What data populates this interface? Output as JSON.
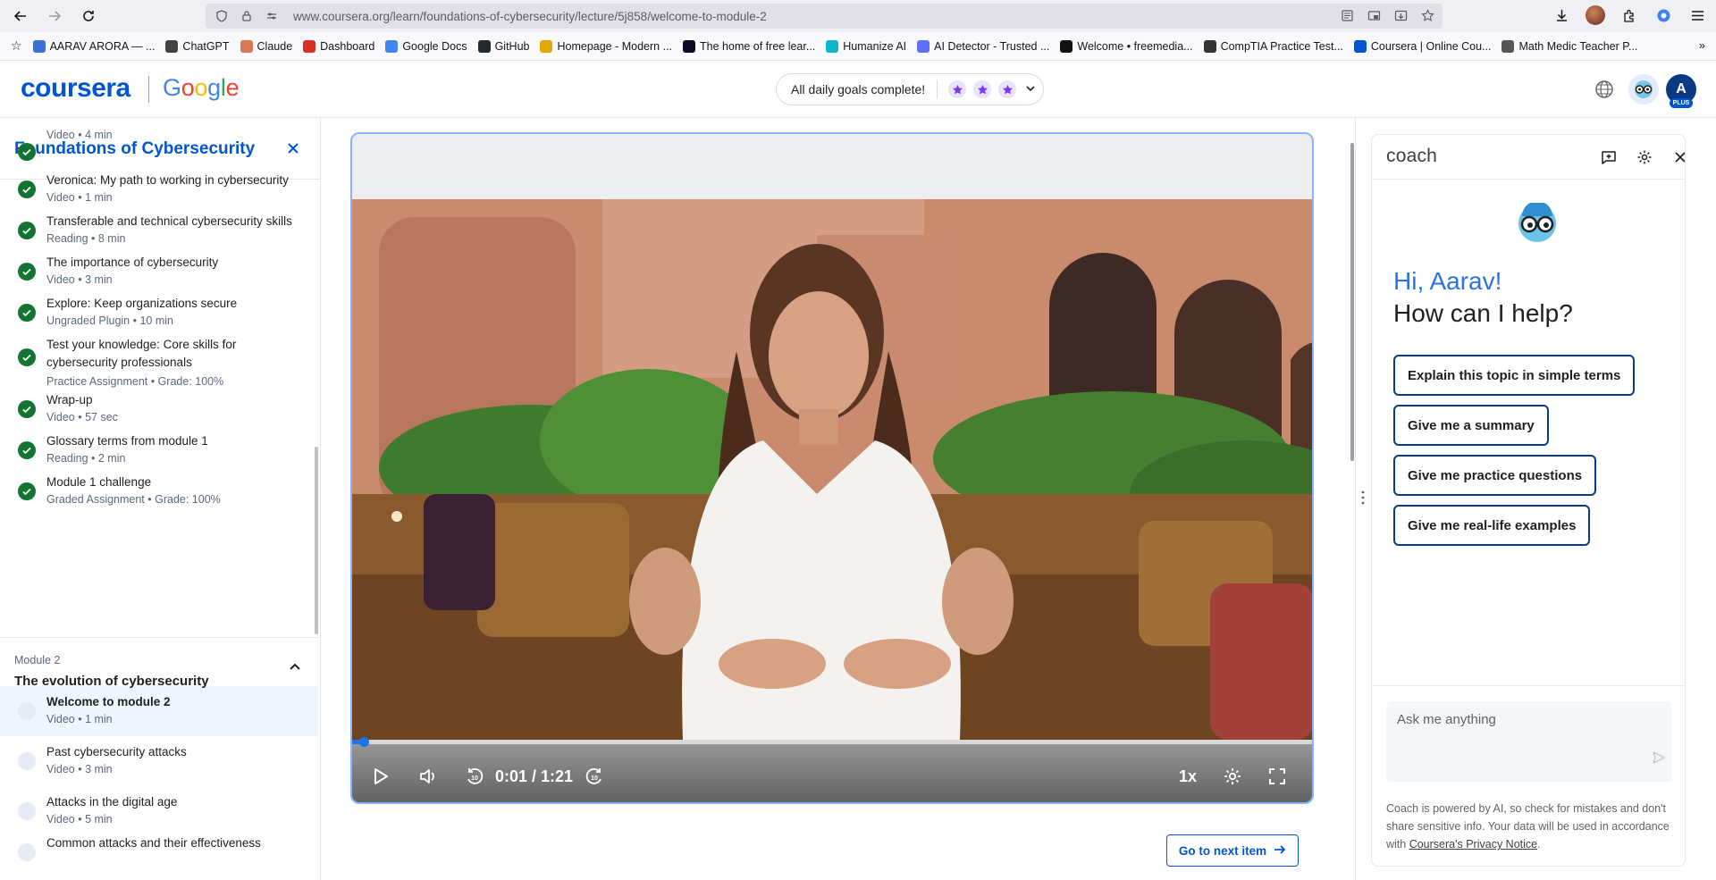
{
  "browser": {
    "url": "www.coursera.org/learn/foundations-of-cybersecurity/lecture/5j858/welcome-to-module-2",
    "bookmarks": [
      {
        "label": "AARAV ARORA — ...",
        "color": "#3b6fd8"
      },
      {
        "label": "ChatGPT",
        "color": "#444444"
      },
      {
        "label": "Claude",
        "color": "#d97757"
      },
      {
        "label": "Dashboard",
        "color": "#d93025"
      },
      {
        "label": "Google Docs",
        "color": "#4285f4"
      },
      {
        "label": "GitHub",
        "color": "#24292f"
      },
      {
        "label": "Homepage - Modern ...",
        "color": "#e0a800"
      },
      {
        "label": "The home of free lear...",
        "color": "#0a0a23"
      },
      {
        "label": "Humanize AI",
        "color": "#11b5c9"
      },
      {
        "label": "AI Detector - Trusted ...",
        "color": "#5f6fff"
      },
      {
        "label": "Welcome • freemedia...",
        "color": "#111111"
      },
      {
        "label": "CompTIA Practice Test...",
        "color": "#333333"
      },
      {
        "label": "Coursera | Online Cou...",
        "color": "#0056d2"
      },
      {
        "label": "Math Medic Teacher P...",
        "color": "#555555"
      }
    ]
  },
  "header": {
    "logo": "coursera",
    "partner": [
      "G",
      "o",
      "o",
      "g",
      "l",
      "e"
    ],
    "goals_label": "All daily goals complete!",
    "user_initial": "A",
    "plan_badge": "PLUS"
  },
  "sidebar": {
    "course_title": "Foundations of Cybersecurity",
    "completed_items": [
      {
        "title": "",
        "meta": "Video • 4 min"
      },
      {
        "title": "Veronica: My path to working in cybersecurity",
        "meta": "Video • 1 min"
      },
      {
        "title": "Transferable and technical cybersecurity skills",
        "meta": "Reading • 8 min"
      },
      {
        "title": "The importance of cybersecurity",
        "meta": "Video • 3 min"
      },
      {
        "title": "Explore: Keep organizations secure",
        "meta": "Ungraded Plugin • 10 min"
      },
      {
        "title": "Test your knowledge: Core skills for cybersecurity professionals",
        "meta": "Practice Assignment • Grade: 100%"
      },
      {
        "title": "Wrap-up",
        "meta": "Video • 57 sec"
      },
      {
        "title": "Glossary terms from module 1",
        "meta": "Reading • 2 min"
      },
      {
        "title": "Module 1 challenge",
        "meta": "Graded Assignment • Grade: 100%"
      }
    ],
    "module": {
      "number": "Module 2",
      "title": "The evolution of cybersecurity"
    },
    "module_items": [
      {
        "title": "Welcome to module 2",
        "meta": "Video • 1 min",
        "active": true
      },
      {
        "title": "Past cybersecurity attacks",
        "meta": "Video • 3 min"
      },
      {
        "title": "Attacks in the digital age",
        "meta": "Video • 5 min"
      },
      {
        "title": "Common attacks and their effectiveness",
        "meta": ""
      }
    ]
  },
  "video": {
    "current_time": "0:01",
    "duration": "1:21",
    "time_display": "0:01 / 1:21",
    "progress": 0.0123,
    "speed": "1x",
    "accent_color": "#1a73e8"
  },
  "next_button": {
    "label": "Go to next item"
  },
  "coach": {
    "title": "coach",
    "greeting": "Hi, Aarav!",
    "prompt": "How can I help?",
    "chips": [
      "Explain this topic in simple terms",
      "Give me a summary",
      "Give me practice questions",
      "Give me real-life examples"
    ],
    "input_placeholder": "Ask me anything",
    "disclaimer_text": "Coach is powered by AI, so check for mistakes and don't share sensitive info. Your data will be used in accordance with ",
    "disclaimer_link": "Coursera's Privacy Notice",
    "disclaimer_end": "."
  }
}
